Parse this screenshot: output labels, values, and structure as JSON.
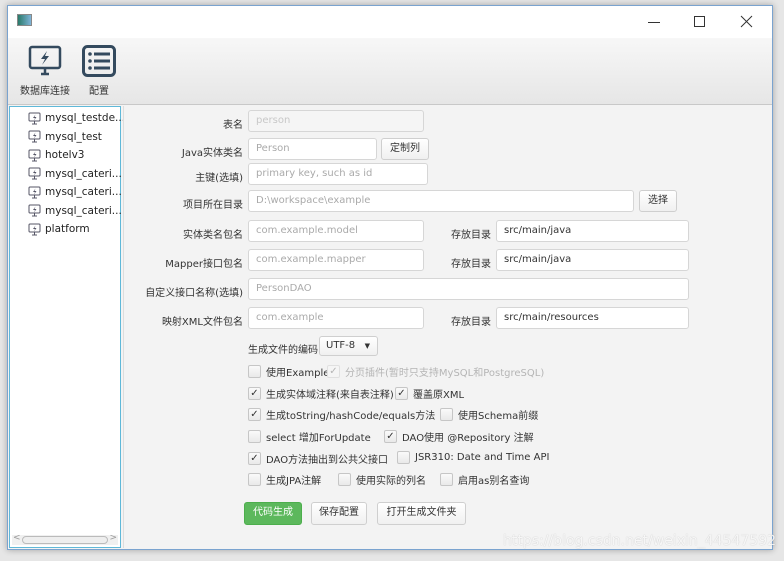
{
  "window": {
    "controls": {
      "minimize": "minimize-icon",
      "maximize": "maximize-icon",
      "close": "close-icon"
    }
  },
  "toolbar": {
    "db_connect": "数据库连接",
    "config": "配置"
  },
  "tree": {
    "items": [
      "mysql_testde...",
      "mysql_test",
      "hotelv3",
      "mysql_cateri...",
      "mysql_cateri...",
      "mysql_cateri...",
      "platform"
    ]
  },
  "form": {
    "table_name": {
      "label": "表名",
      "value": "person"
    },
    "entity_name": {
      "label": "Java实体类名",
      "value": "Person",
      "button": "定制列"
    },
    "primary_key": {
      "label": "主键(选填)",
      "placeholder": "primary key, such as id"
    },
    "project_dir": {
      "label": "项目所在目录",
      "placeholder": "D:\\workspace\\example",
      "button": "选择"
    },
    "model_pkg": {
      "label": "实体类名包名",
      "placeholder": "com.example.model",
      "dir_label": "存放目录",
      "dir": "src/main/java"
    },
    "mapper_pkg": {
      "label": "Mapper接口包名",
      "placeholder": "com.example.mapper",
      "dir_label": "存放目录",
      "dir": "src/main/java"
    },
    "custom_iface": {
      "label": "自定义接口名称(选填)",
      "placeholder": "PersonDAO"
    },
    "xml_pkg": {
      "label": "映射XML文件包名",
      "placeholder": "com.example",
      "dir_label": "存放目录",
      "dir": "src/main/resources"
    },
    "encoding": {
      "label": "生成文件的编码",
      "value": "UTF-8"
    }
  },
  "options": [
    {
      "label": "使用Example",
      "checked": false
    },
    {
      "label": "分页插件(暂时只支持MySQL和PostgreSQL)",
      "checked": true,
      "disabled": true
    },
    {
      "label": "生成实体域注释(来自表注释)",
      "checked": true
    },
    {
      "label": "覆盖原XML",
      "checked": true
    },
    {
      "label": "生成toString/hashCode/equals方法",
      "checked": true
    },
    {
      "label": "使用Schema前缀",
      "checked": false
    },
    {
      "label": "select 增加ForUpdate",
      "checked": false
    },
    {
      "label": "DAO使用 @Repository 注解",
      "checked": true
    },
    {
      "label": "DAO方法抽出到公共父接口",
      "checked": true
    },
    {
      "label": "JSR310: Date and Time API",
      "checked": false
    },
    {
      "label": "生成JPA注解",
      "checked": false
    },
    {
      "label": "使用实际的列名",
      "checked": false
    },
    {
      "label": "启用as别名查询",
      "checked": false
    }
  ],
  "actions": {
    "generate": "代码生成",
    "save": "保存配置",
    "open_folder": "打开生成文件夹"
  },
  "colors": {
    "primary": "#5cb85c",
    "tree_border": "#5fb8d8"
  },
  "watermark": "https://blog.csdn.net/weixin_44547592"
}
